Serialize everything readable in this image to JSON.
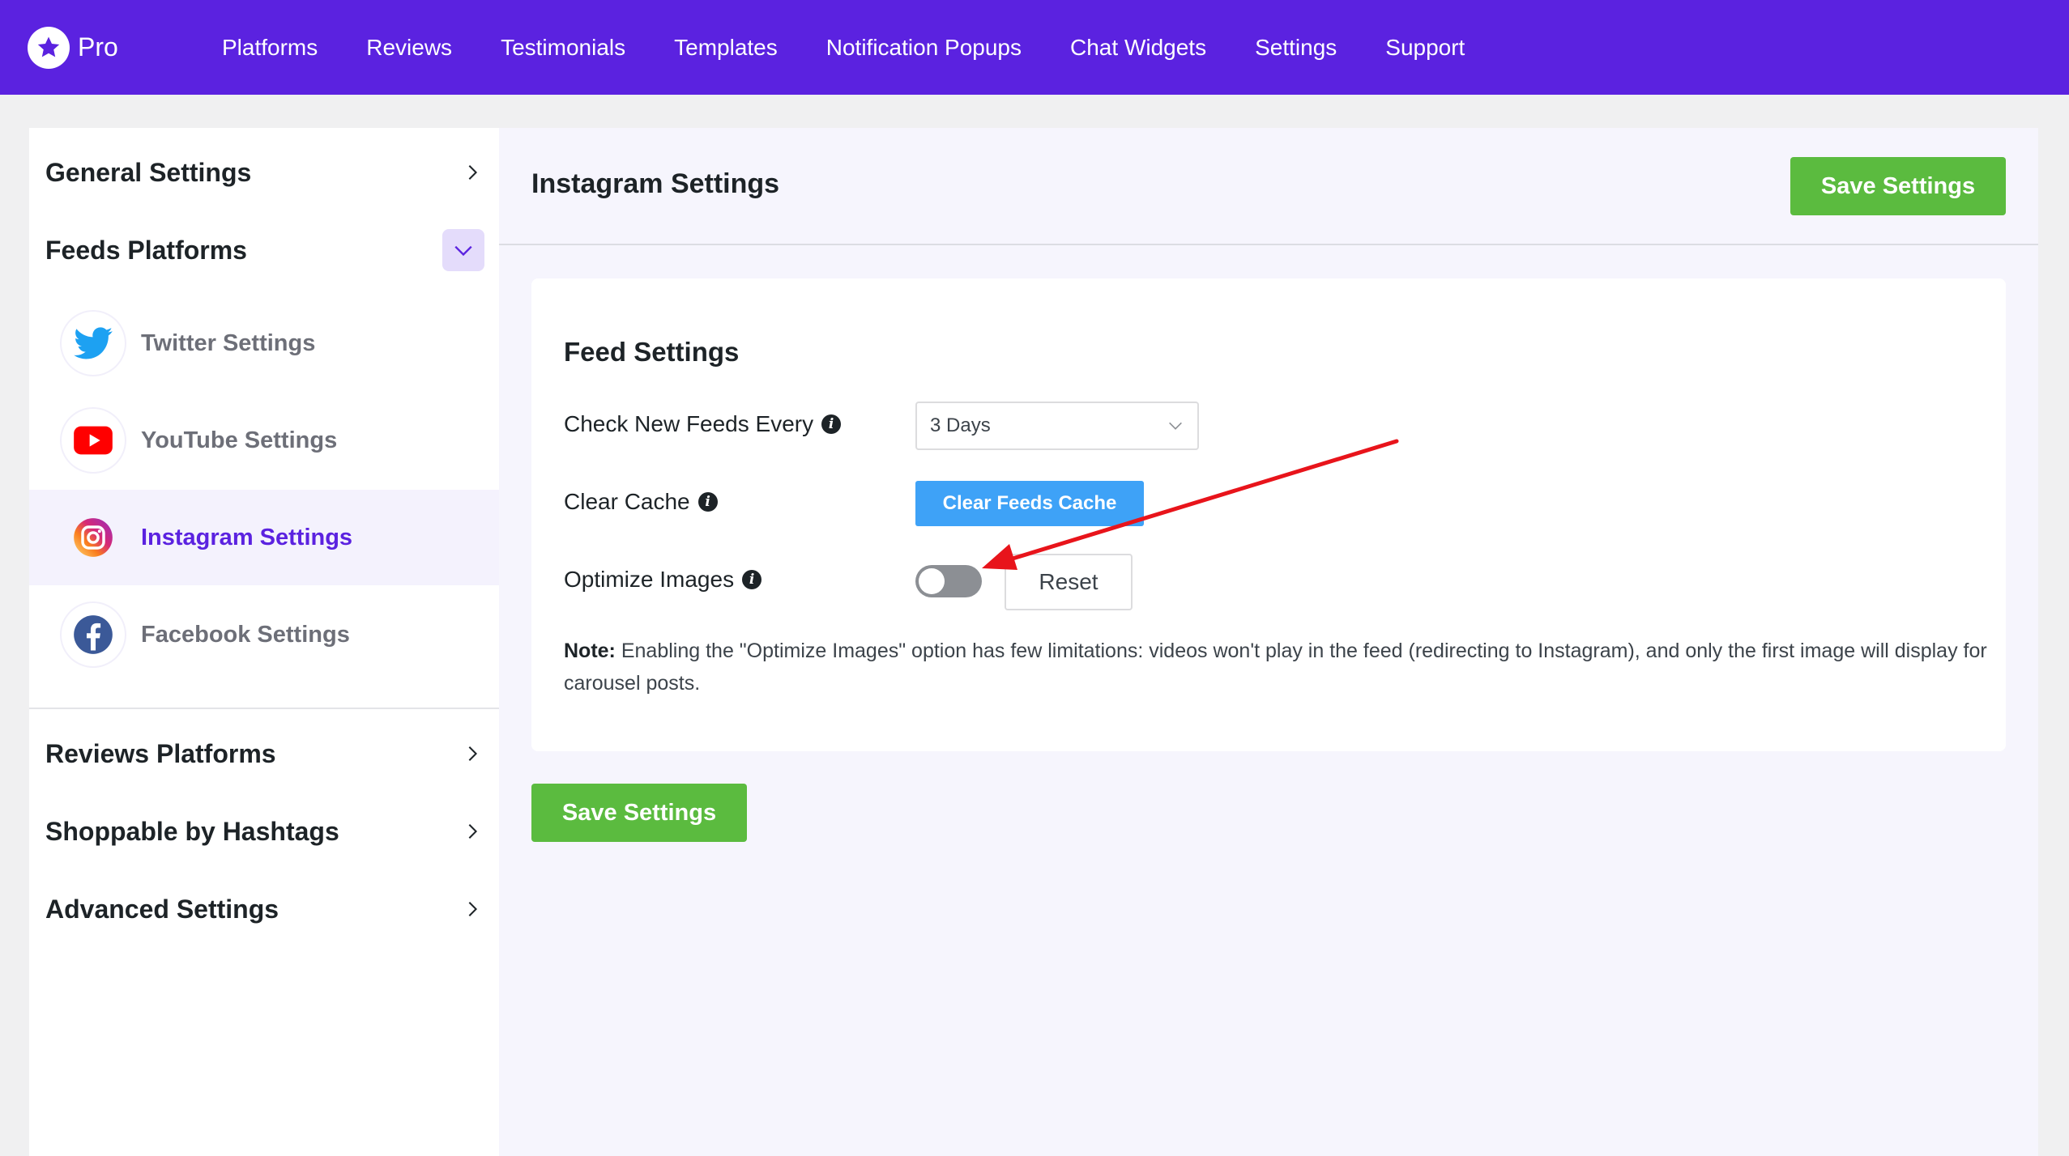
{
  "brand": {
    "name": "Pro"
  },
  "nav": {
    "items": [
      {
        "label": "Platforms"
      },
      {
        "label": "Reviews"
      },
      {
        "label": "Testimonials"
      },
      {
        "label": "Templates"
      },
      {
        "label": "Notification Popups"
      },
      {
        "label": "Chat Widgets"
      },
      {
        "label": "Settings"
      },
      {
        "label": "Support"
      }
    ]
  },
  "sidebar": {
    "general": "General Settings",
    "feeds": "Feeds Platforms",
    "platforms": [
      {
        "label": "Twitter Settings",
        "icon": "twitter-icon"
      },
      {
        "label": "YouTube Settings",
        "icon": "youtube-icon"
      },
      {
        "label": "Instagram Settings",
        "icon": "instagram-icon",
        "active": true
      },
      {
        "label": "Facebook Settings",
        "icon": "facebook-icon"
      }
    ],
    "reviews": "Reviews Platforms",
    "shoppable": "Shoppable by Hashtags",
    "advanced": "Advanced Settings"
  },
  "main": {
    "title": "Instagram Settings",
    "save_label": "Save Settings",
    "card": {
      "title": "Feed Settings",
      "check_label": "Check New Feeds Every",
      "check_value": "3 Days",
      "clear_label": "Clear Cache",
      "clear_button": "Clear Feeds Cache",
      "optimize_label": "Optimize Images",
      "optimize_enabled": false,
      "reset_button": "Reset",
      "note_prefix": "Note:",
      "note_text": "Enabling the \"Optimize Images\" option has few limitations: videos won't play in the feed (redirecting to Instagram), and only the first image will display for carousel posts."
    }
  },
  "colors": {
    "brand": "#5b22e0",
    "save": "#5bbb3f",
    "clear": "#3ea2f7",
    "annotation": "#e8141b"
  }
}
